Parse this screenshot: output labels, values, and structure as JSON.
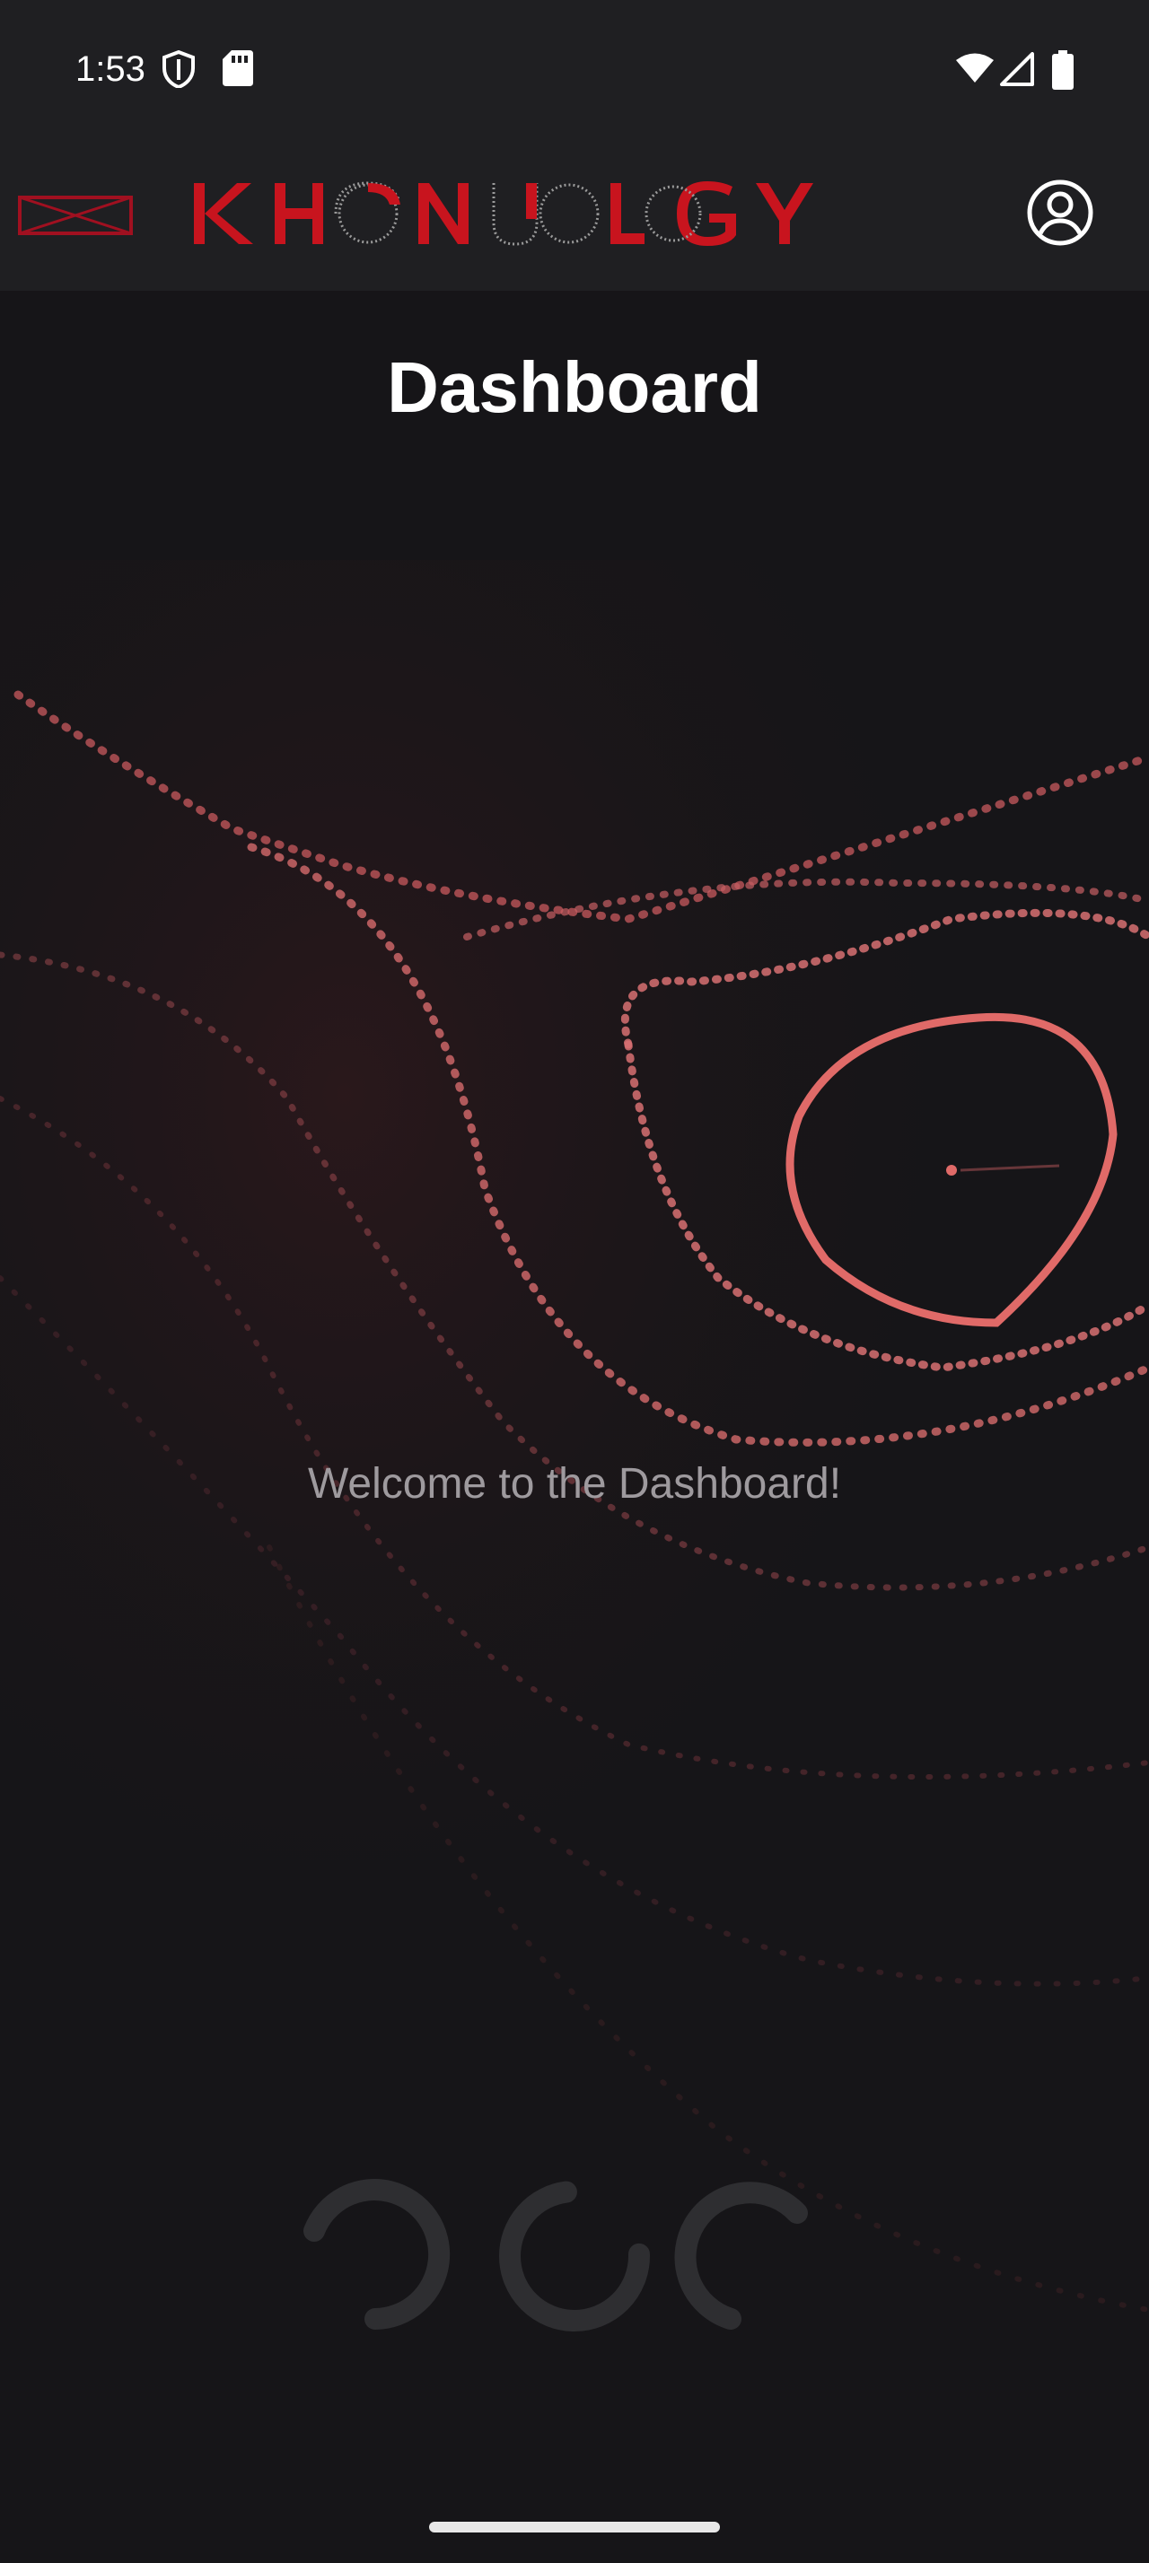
{
  "status_bar": {
    "time": "1:53",
    "icons": [
      "shield-icon",
      "sd-card-icon",
      "wifi-icon",
      "cell-signal-icon",
      "battery-icon"
    ]
  },
  "app_bar": {
    "menu_icon": "menu-icon",
    "logo_text": "KHRONOLOGY",
    "profile_icon": "account-circle-icon",
    "brand_color": "#c8141e"
  },
  "main": {
    "title": "Dashboard",
    "welcome_text": "Welcome to the Dashboard!",
    "loader": "loading-dots-icon"
  },
  "colors": {
    "background": "#161518",
    "bar_background": "#1f1f22",
    "accent_contour": "#e06a68"
  }
}
